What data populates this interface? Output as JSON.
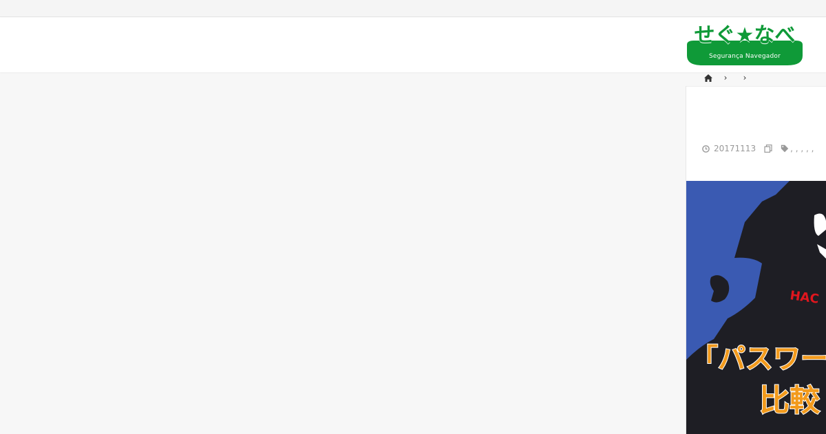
{
  "site": {
    "logo_wordmark": "せぐ★なべ",
    "logo_tagline": "Segurança Navegador",
    "brand_color": "#0f9a38"
  },
  "breadcrumb": {
    "home_icon": "home-icon",
    "separator": "›"
  },
  "post": {
    "date": "20171113",
    "tags": ", , , , ,",
    "date_icon": "clock-icon",
    "copy_icon": "copy-icon",
    "tag_icon": "tag-icon"
  },
  "eyecatch": {
    "badge": "HAC",
    "headline_line1": "「パスワード",
    "headline_line2": "比較",
    "bg_color": "#3b5fb5"
  }
}
